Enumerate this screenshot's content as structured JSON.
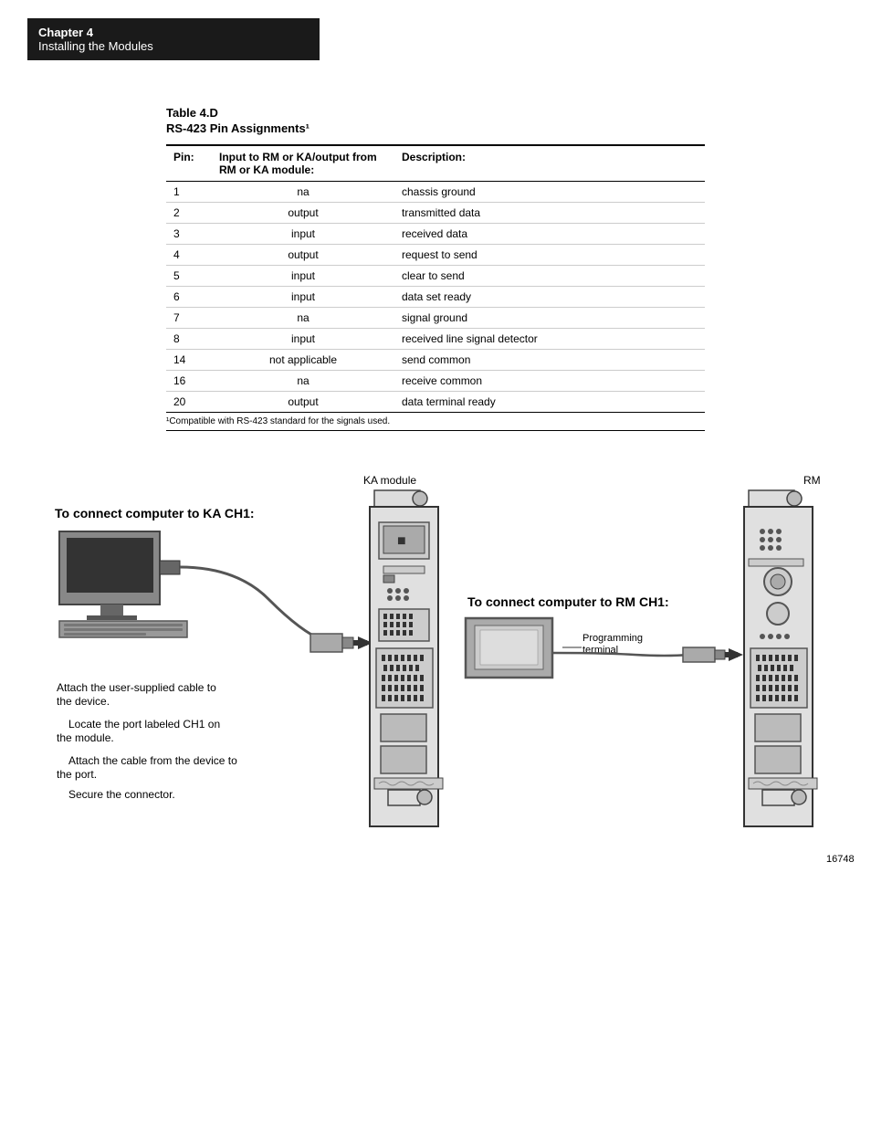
{
  "header": {
    "chapter_num": "Chapter  4",
    "chapter_title": "Installing the Modules"
  },
  "table": {
    "title": "Table 4.D",
    "subtitle": "RS-423 Pin Assignments¹",
    "columns": [
      "Pin:",
      "Input to RM or KA/output from RM or KA module:",
      "Description:"
    ],
    "rows": [
      [
        "1",
        "na",
        "chassis ground"
      ],
      [
        "2",
        "output",
        "transmitted data"
      ],
      [
        "3",
        "input",
        "received data"
      ],
      [
        "4",
        "output",
        "request to send"
      ],
      [
        "5",
        "input",
        "clear to send"
      ],
      [
        "6",
        "input",
        "data set ready"
      ],
      [
        "7",
        "na",
        "signal ground"
      ],
      [
        "8",
        "input",
        "received line signal detector"
      ],
      [
        "14",
        "not applicable",
        "send common"
      ],
      [
        "16",
        "na",
        "receive common"
      ],
      [
        "20",
        "output",
        "data terminal ready"
      ]
    ],
    "footnote": "¹Compatible with RS-423 standard for the signals used."
  },
  "diagram": {
    "ka_module_label": "KA module",
    "rm_label": "RM",
    "connect_ka_title": "To connect computer to KA CH1:",
    "connect_rm_title": "To connect computer to RM CH1:",
    "prog_terminal_label": "Programming\nterminal",
    "instructions": [
      "Attach the user-supplied cable to the device.",
      "Locate the port labeled CH1 on the module.",
      "Attach the cable from the device to the port.",
      "Secure the connector."
    ],
    "figure_number": "16748"
  }
}
